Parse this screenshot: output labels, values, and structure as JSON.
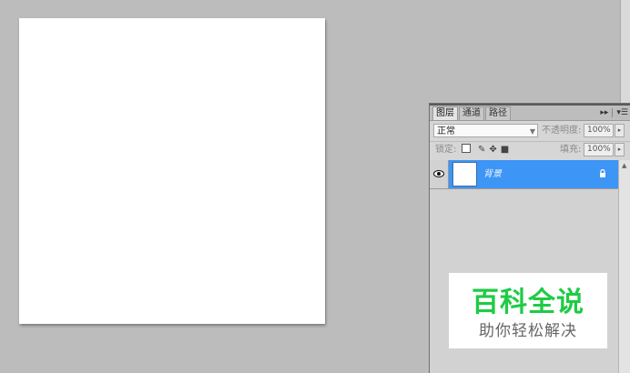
{
  "layers_panel": {
    "tabs": [
      {
        "label": "图层",
        "active": true
      },
      {
        "label": "通道",
        "active": false
      },
      {
        "label": "路径",
        "active": false
      }
    ],
    "collapse_icon": "double-chevron-right-icon",
    "menu_icon": "panel-menu-icon",
    "blend_mode": "正常",
    "opacity_label": "不透明度:",
    "opacity_value": "100%",
    "lock_label": "锁定:",
    "fill_label": "填充:",
    "fill_value": "100%",
    "layers": [
      {
        "name": "背景",
        "visible": true,
        "selected": true,
        "locked": true
      }
    ],
    "selected_color": "#3d95f5"
  },
  "watermark": {
    "title": "百科全说",
    "subtitle": "助你轻松解决",
    "title_color": "#1fcb45"
  },
  "canvas_color": "#ffffff",
  "workspace_color": "#bcbcbc"
}
